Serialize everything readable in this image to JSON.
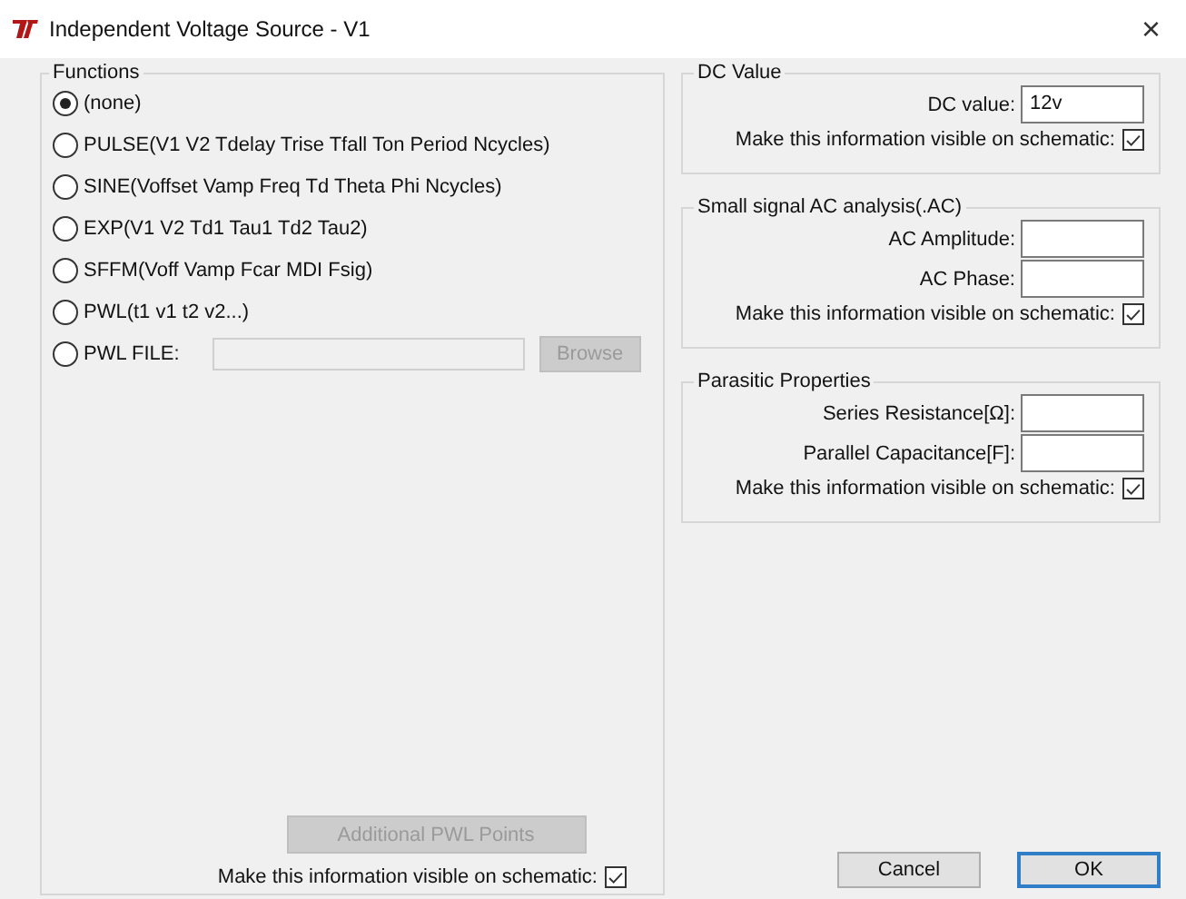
{
  "window": {
    "title": "Independent Voltage Source - V1",
    "close": "×"
  },
  "functions": {
    "title": "Functions",
    "options": [
      {
        "kind": "radio",
        "label": "(none)",
        "selected": true
      },
      {
        "kind": "radio",
        "label": "PULSE(V1 V2 Tdelay Trise Tfall Ton Period Ncycles)",
        "selected": false
      },
      {
        "kind": "radio",
        "label": "SINE(Voffset Vamp Freq Td Theta Phi Ncycles)",
        "selected": false
      },
      {
        "kind": "radio",
        "label": "EXP(V1 V2 Td1 Tau1 Td2 Tau2)",
        "selected": false
      },
      {
        "kind": "radio",
        "label": "SFFM(Voff Vamp Fcar MDI Fsig)",
        "selected": false
      },
      {
        "kind": "radio",
        "label": "PWL(t1 v1 t2 v2...)",
        "selected": false
      },
      {
        "kind": "file",
        "label": "PWL FILE:",
        "selected": false,
        "browse": "Browse",
        "disabled": true
      }
    ],
    "additional_button": {
      "label": "Additional PWL Points",
      "disabled": true
    },
    "visible": {
      "label": "Make this information visible on schematic:",
      "checked": true
    }
  },
  "groups": [
    {
      "title": "DC Value",
      "fields": [
        {
          "label": "DC value:",
          "value": "12v"
        }
      ],
      "visible": {
        "label": "Make this information visible on schematic:",
        "checked": true
      }
    },
    {
      "title": "Small signal AC analysis(.AC)",
      "fields": [
        {
          "label": "AC Amplitude:"
        },
        {
          "label": "AC Phase:"
        }
      ],
      "visible": {
        "label": "Make this information visible on schematic:",
        "checked": true
      }
    },
    {
      "title": "Parasitic Properties",
      "fields": [
        {
          "label": "Series Resistance[Ω]:"
        },
        {
          "label": "Parallel Capacitance[F]:"
        }
      ],
      "visible": {
        "label": "Make this information visible on schematic:",
        "checked": true
      }
    }
  ],
  "buttons": [
    {
      "label": "Cancel",
      "default": false
    },
    {
      "label": "OK",
      "default": true
    }
  ]
}
